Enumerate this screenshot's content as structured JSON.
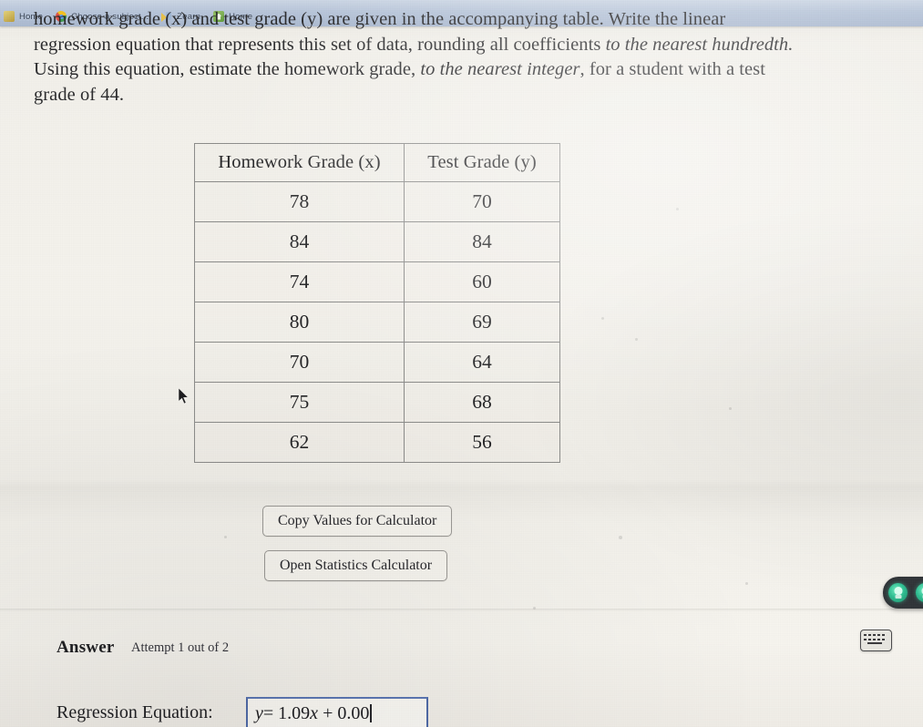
{
  "browser": {
    "tabs": [
      {
        "label": "Home",
        "icon": "home-icon"
      },
      {
        "label": "Choose a subject...",
        "icon": "chrome-icon"
      },
      {
        "label": "Zearn",
        "icon": "zearn-icon"
      },
      {
        "label": "Home",
        "icon": "home-green-icon"
      }
    ]
  },
  "problem": {
    "line1": "homework grade (x) and test grade (y) are given in the accompanying table. Write the linear",
    "line2_a": "regression equation that represents this set of data, rounding all coefficients ",
    "line2_em": "to the nearest hundredth.",
    "line3_a": "Using this equation, estimate the homework grade, ",
    "line3_em": "to the nearest integer",
    "line3_b": ", for a student with a test",
    "line4": "grade of 44."
  },
  "table": {
    "headers": [
      "Homework Grade (x)",
      "Test Grade (y)"
    ],
    "rows": [
      [
        "78",
        "70"
      ],
      [
        "84",
        "84"
      ],
      [
        "74",
        "60"
      ],
      [
        "80",
        "69"
      ],
      [
        "70",
        "64"
      ],
      [
        "75",
        "68"
      ],
      [
        "62",
        "56"
      ]
    ]
  },
  "actions": {
    "copy_values": "Copy Values for Calculator",
    "open_calculator": "Open Statistics Calculator"
  },
  "answer": {
    "heading": "Answer",
    "attempt": "Attempt 1 out of 2",
    "equation_label": "Regression Equation:",
    "equation_value_prefix": "y",
    "equation_value_eq": "= 1.09",
    "equation_value_var": "x",
    "equation_value_suffix": "+ 0.00"
  },
  "overlays": {
    "hint_pill_icon": "lightbulb-icon",
    "keyboard_icon": "keyboard-icon"
  },
  "colors": {
    "tabstrip": "#b7c5d9",
    "page_bg": "#f2f0ea",
    "input_border": "#4f6aa8",
    "hint_pill_bg": "#303438",
    "bulb_green": "#2fbf92",
    "text": "#232325"
  }
}
